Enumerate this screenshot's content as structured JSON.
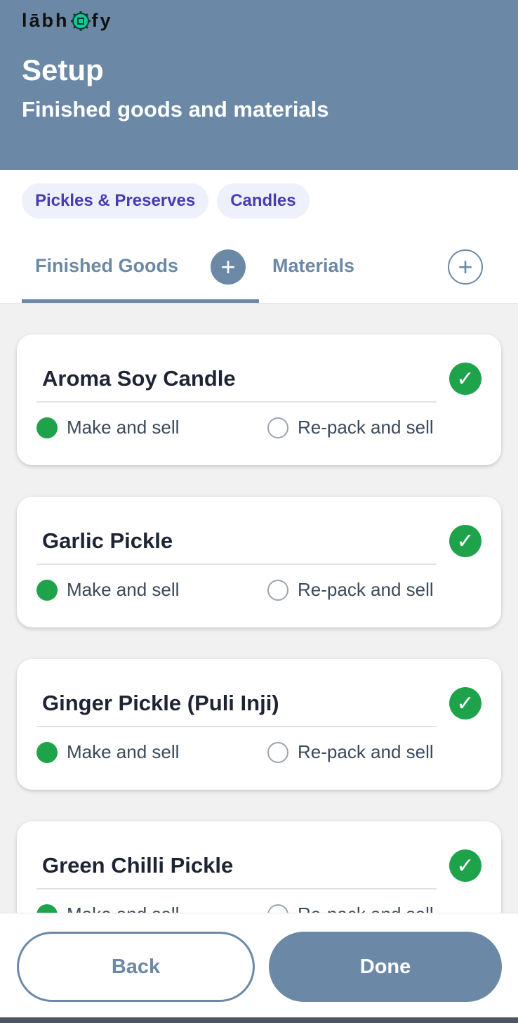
{
  "header": {
    "logo_left": "lābh",
    "logo_right": "fy",
    "title": "Setup",
    "subtitle": "Finished goods and materials"
  },
  "categories": [
    "Pickles & Preserves",
    "Candles"
  ],
  "tabs": [
    {
      "label": "Finished Goods",
      "active": true
    },
    {
      "label": "Materials",
      "active": false
    }
  ],
  "items": [
    {
      "name": "Aroma Soy Candle",
      "make_label": "Make and sell",
      "repack_label": "Re-pack and sell",
      "selected": "make",
      "checked": true
    },
    {
      "name": "Garlic Pickle",
      "make_label": "Make and sell",
      "repack_label": "Re-pack and sell",
      "selected": "make",
      "checked": true
    },
    {
      "name": "Ginger Pickle (Puli Inji)",
      "make_label": "Make and sell",
      "repack_label": "Re-pack and sell",
      "selected": "make",
      "checked": true
    },
    {
      "name": "Green Chilli Pickle",
      "make_label": "Make and sell",
      "repack_label": "Re-pack and sell",
      "selected": "make",
      "checked": true
    }
  ],
  "footer": {
    "back_label": "Back",
    "done_label": "Done"
  },
  "colors": {
    "primary": "#6b89a6",
    "success": "#1fa34a",
    "chip_bg": "#eef0fb",
    "chip_text": "#4a3bb0"
  }
}
